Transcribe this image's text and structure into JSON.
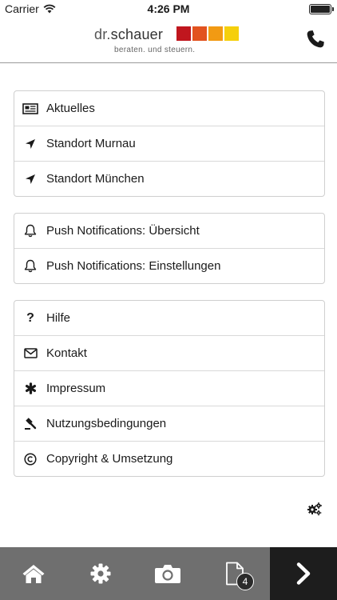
{
  "status_bar": {
    "carrier": "Carrier",
    "time": "4:26 PM"
  },
  "header": {
    "logo_prefix": "dr.",
    "logo_name": "schauer",
    "logo_tagline": "beraten. und steuern.",
    "logo_colors": [
      "#c0161e",
      "#e2531f",
      "#f29a13",
      "#f5cf0c"
    ],
    "phone_icon": "phone-icon"
  },
  "groups": [
    {
      "items": [
        {
          "label": "Aktuelles",
          "icon": "newspaper-icon"
        },
        {
          "label": "Standort Murnau",
          "icon": "location-arrow-icon"
        },
        {
          "label": "Standort München",
          "icon": "location-arrow-icon"
        }
      ]
    },
    {
      "items": [
        {
          "label": "Push Notifications: Übersicht",
          "icon": "bell-icon"
        },
        {
          "label": "Push Notifications: Einstellungen",
          "icon": "bell-icon"
        }
      ]
    },
    {
      "items": [
        {
          "label": "Hilfe",
          "icon": "question-icon"
        },
        {
          "label": "Kontakt",
          "icon": "envelope-icon"
        },
        {
          "label": "Impressum",
          "icon": "asterisk-icon"
        },
        {
          "label": "Nutzungsbedingungen",
          "icon": "gavel-icon"
        },
        {
          "label": "Copyright & Umsetzung",
          "icon": "copyright-icon"
        }
      ]
    }
  ],
  "toolbar": {
    "buttons": [
      "home-icon",
      "gear-icon",
      "camera-icon",
      "document-icon",
      "chevron-right-icon"
    ],
    "document_badge": "4",
    "background": "#6f6f6f",
    "next_background": "#1d1d1d"
  }
}
